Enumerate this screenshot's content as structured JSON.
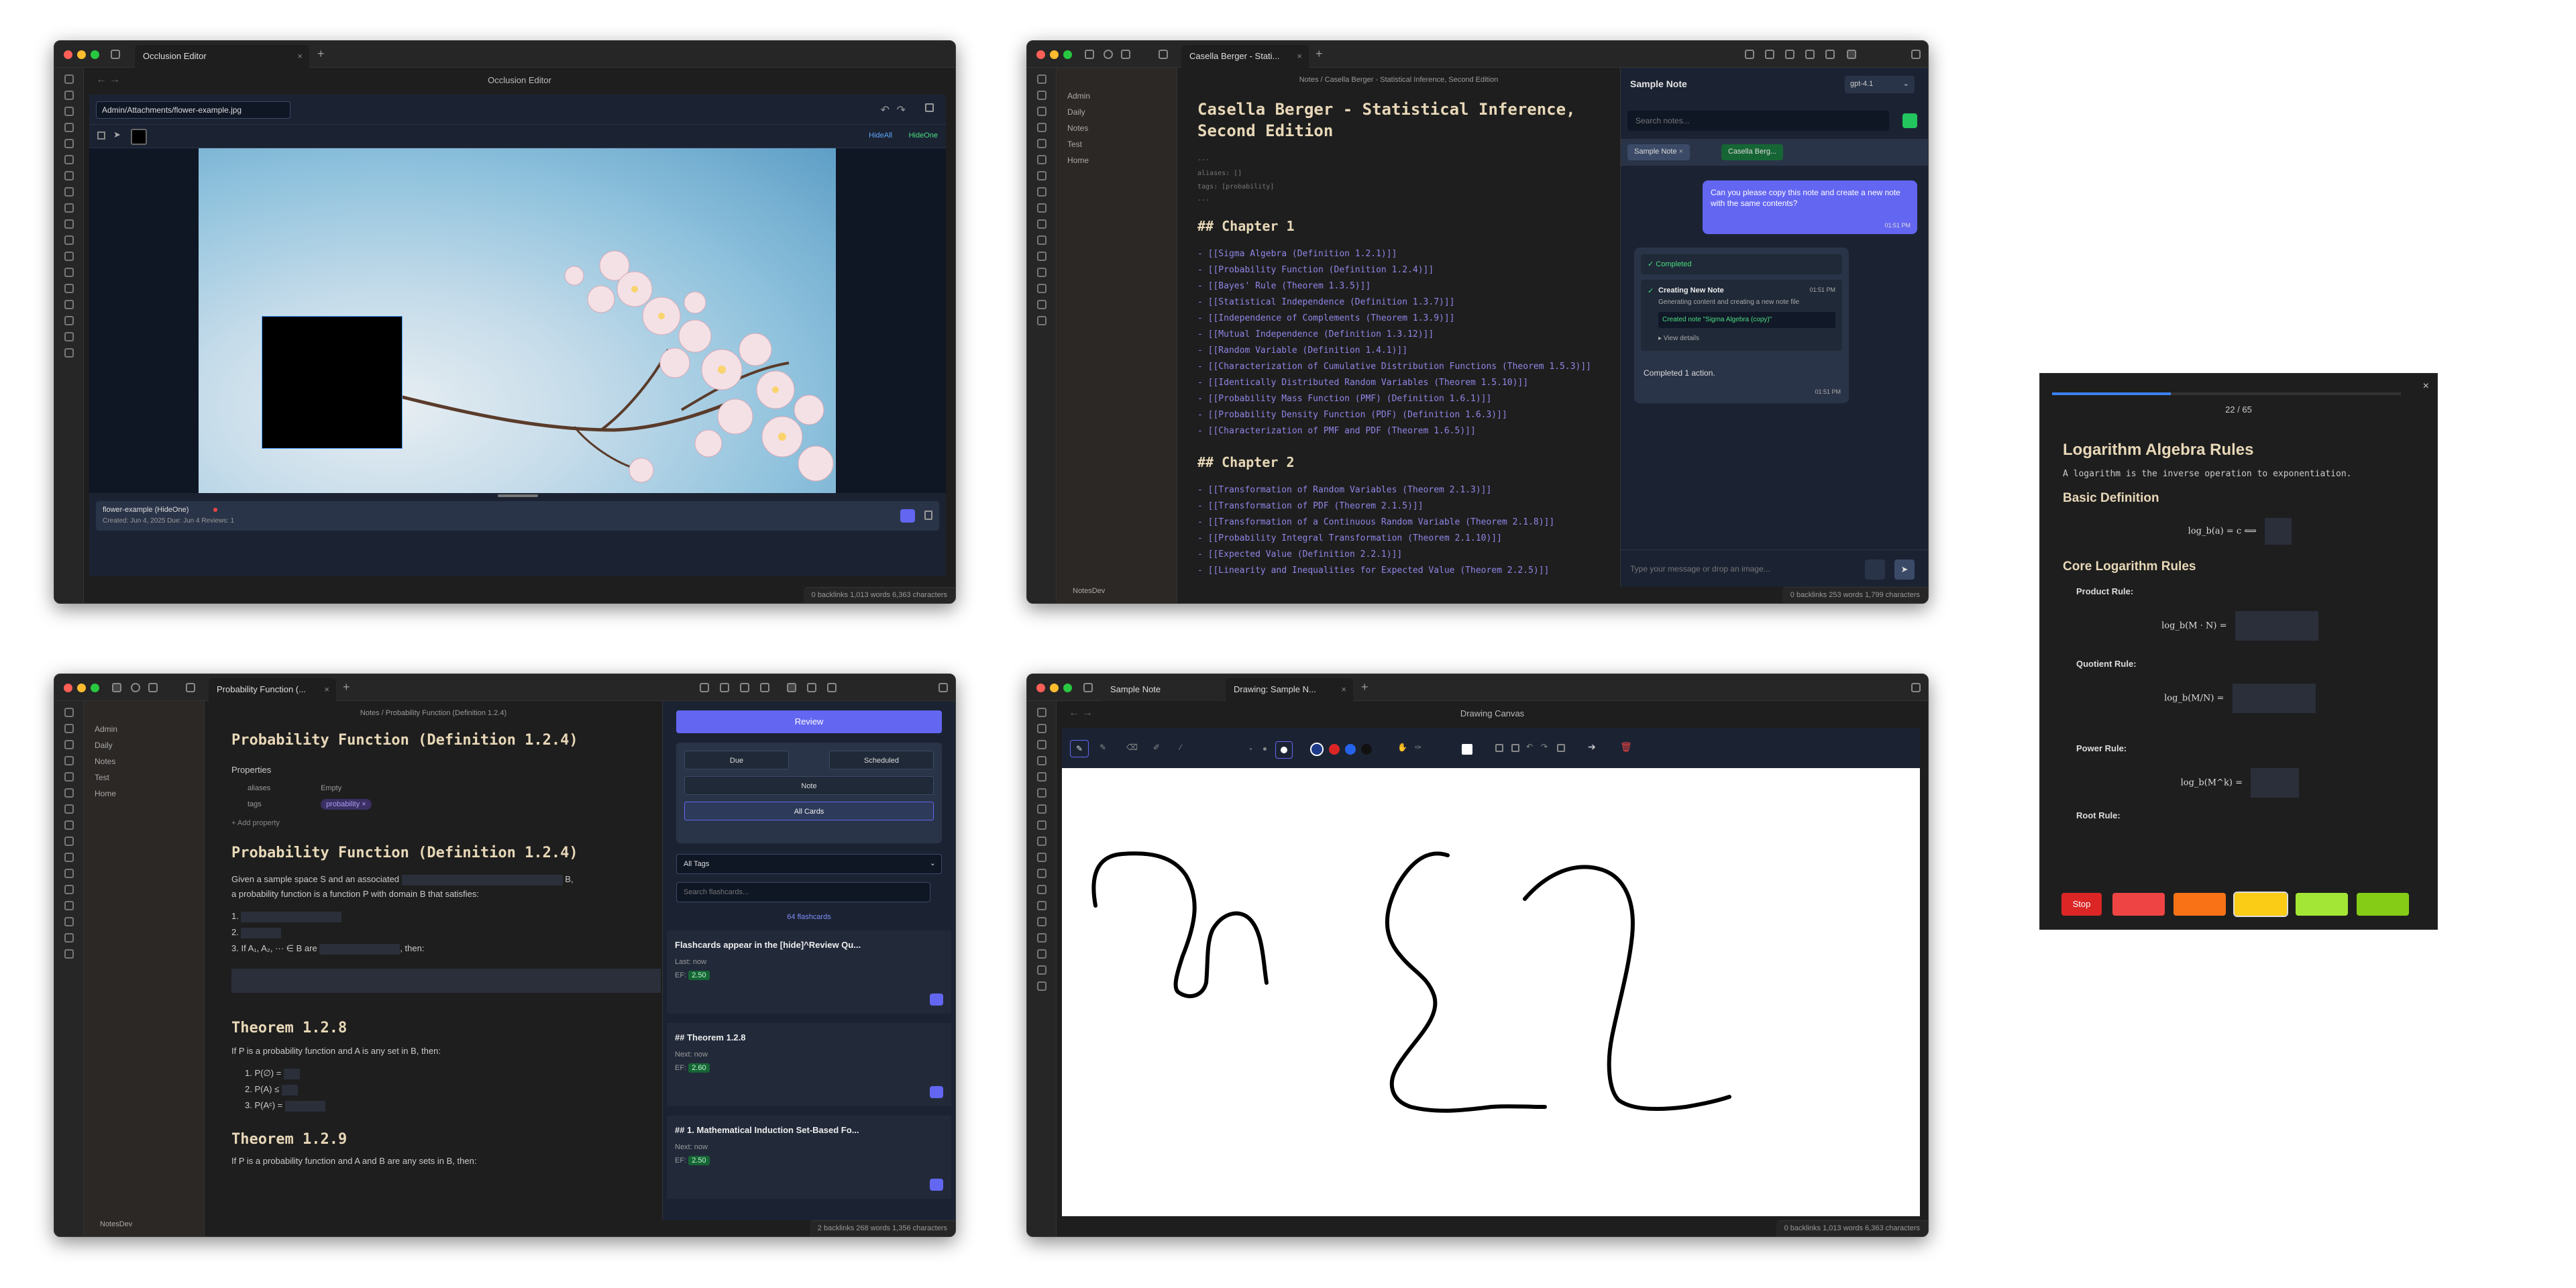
{
  "occlusion": {
    "tab_title": "Occlusion Editor",
    "header_title": "Occlusion Editor",
    "path_value": "Admin/Attachments/flower-example.jpg",
    "hide_all": "HideAll",
    "hide_one": "HideOne",
    "card_name": "flower-example (HideOne)",
    "card_meta": "Created: Jun 4, 2025  Due: Jun 4  Reviews: 1",
    "status": "0 backlinks    1,013 words  6,363 characters"
  },
  "casella": {
    "tab_title": "Casella Berger - Stati...",
    "breadcrumb": "Notes / Casella Berger - Statistical Inference, Second Edition",
    "tree": [
      "Admin",
      "Daily",
      "Notes",
      "Test",
      "Home"
    ],
    "vault_name": "NotesDev",
    "title": "Casella Berger - Statistical Inference, Second Edition",
    "fm_open": "---",
    "fm_aliases": "aliases: []",
    "fm_tags": "tags: [probability]",
    "fm_close": "---",
    "ch1": "## Chapter 1",
    "ch1_links": [
      "- [[Sigma Algebra (Definition 1.2.1)]]",
      "- [[Probability Function (Definition 1.2.4)]]",
      "- [[Bayes' Rule (Theorem 1.3.5)]]",
      "- [[Statistical Independence (Definition 1.3.7)]]",
      "- [[Independence of Complements (Theorem 1.3.9)]]",
      "- [[Mutual Independence (Definition 1.3.12)]]",
      "- [[Random Variable (Definition 1.4.1)]]",
      "- [[Characterization of Cumulative Distribution Functions (Theorem 1.5.3)]]",
      "- [[Identically Distributed Random Variables (Theorem 1.5.10)]]",
      "- [[Probability Mass Function (PMF) (Definition 1.6.1)]]",
      "- [[Probability Density Function (PDF) (Definition 1.6.3)]]",
      "- [[Characterization of PMF and PDF (Theorem 1.6.5)]]"
    ],
    "ch2": "## Chapter 2",
    "ch2_links": [
      "- [[Transformation of Random Variables (Theorem 2.1.3)]]",
      "- [[Transformation of PDF (Theorem 2.1.5)]]",
      "- [[Transformation of a Continuous Random Variable (Theorem 2.1.8)]]",
      "- [[Probability Integral Transformation (Theorem 2.1.10)]]",
      "- [[Expected Value (Definition 2.2.1)]]",
      "- [[Linearity and Inequalities for Expected Value (Theorem 2.2.5)]]"
    ],
    "chat_title": "Sample Note",
    "model": "gpt-4.1",
    "search_placeholder": "Search notes...",
    "chip1": "Sample Note",
    "chip2": "Casella Berg...",
    "user_msg": "Can you please copy this note and create a new note with the same contents?",
    "user_time": "01:51 PM",
    "completed": "Completed",
    "step_title": "Creating New Note",
    "step_time": "01:51 PM",
    "step_desc": "Generating content and creating a new note file",
    "created_note": "Created note \"Sigma Algebra (copy)\"",
    "view_details": "▸ View details",
    "summary": "Completed 1 action.",
    "summary_time": "01:51 PM",
    "msg_placeholder": "Type your message or drop an image...",
    "status": "0 backlinks    253 words  1,799 characters"
  },
  "flash": {
    "progress": 0.34,
    "counter": "22 / 65",
    "h1": "Logarithm Algebra Rules",
    "intro": "A logarithm is the inverse operation to exponentiation.",
    "h2a": "Basic Definition",
    "def": "log_b(a) = c ⟺",
    "h2b": "Core Logarithm Rules",
    "rules": [
      {
        "label": "Product Rule:",
        "formula": "log_b(M · N) ="
      },
      {
        "label": "Quotient Rule:",
        "formula": "log_b(M/N) ="
      },
      {
        "label": "Power Rule:",
        "formula": "log_b(M^k) ="
      },
      {
        "label": "Root Rule:",
        "formula": ""
      }
    ],
    "stop": "Stop",
    "grade_colors": [
      "#ef4444",
      "#f97316",
      "#facc15",
      "#a3e635",
      "#84cc16"
    ]
  },
  "probability": {
    "tab_title": "Probability Function (...",
    "breadcrumb": "Notes / Probability Function (Definition 1.2.4)",
    "tree": [
      "Admin",
      "Daily",
      "Notes",
      "Test",
      "Home"
    ],
    "vault_name": "NotesDev",
    "title": "Probability Function (Definition 1.2.4)",
    "properties": "Properties",
    "prop_aliases": "aliases",
    "prop_aliases_val": "Empty",
    "prop_tags": "tags",
    "tag": "probability",
    "add_property": "+ Add property",
    "h1": "Probability Function (Definition 1.2.4)",
    "p1a": "Given a sample space S and an associated",
    "p1b": "B,",
    "p1c": "a probability function is a function P with domain B that satisfies:",
    "li1": "1.",
    "li2": "2.",
    "li3a": "3. If A₁, A₂, ··· ∈ B are",
    "li3b": ", then:",
    "h2": "Theorem 1.2.8",
    "p2": "If P is a probability function and A is any set in B, then:",
    "t1": "1. P(∅) =",
    "t2": "2. P(A) ≤",
    "t3": "3. P(Aᶜ) =",
    "h3": "Theorem 1.2.9",
    "p3": "If P is a probability function and A and B are any sets in B, then:",
    "review": "Review",
    "due": "Due",
    "scheduled": "Scheduled",
    "note": "Note",
    "all_cards": "All Cards",
    "all_tags": "All Tags",
    "search_placeholder": "Search flashcards...",
    "count": "64 flashcards",
    "cards": [
      {
        "title": "Flashcards appear in the [hide]^Review Qu...",
        "sub": "Last: now",
        "ef_label": "EF:",
        "ef": "2.50"
      },
      {
        "title": "## Theorem 1.2.8",
        "sub": "Next: now",
        "ef_label": "EF:",
        "ef": "2.60"
      },
      {
        "title": "## 1. Mathematical Induction Set-Based Fo...",
        "sub": "Next: now",
        "ef_label": "EF:",
        "ef": "2.50"
      }
    ],
    "status": "2 backlinks    268 words  1,356 characters"
  },
  "drawing": {
    "tab1": "Sample Note",
    "tab2": "Drawing: Sample N...",
    "header": "Drawing Canvas",
    "colors": [
      "#1e3a8a",
      "#dc2626",
      "#2563eb",
      "#111111"
    ],
    "status": "0 backlinks    1,013 words  6,363 characters"
  }
}
